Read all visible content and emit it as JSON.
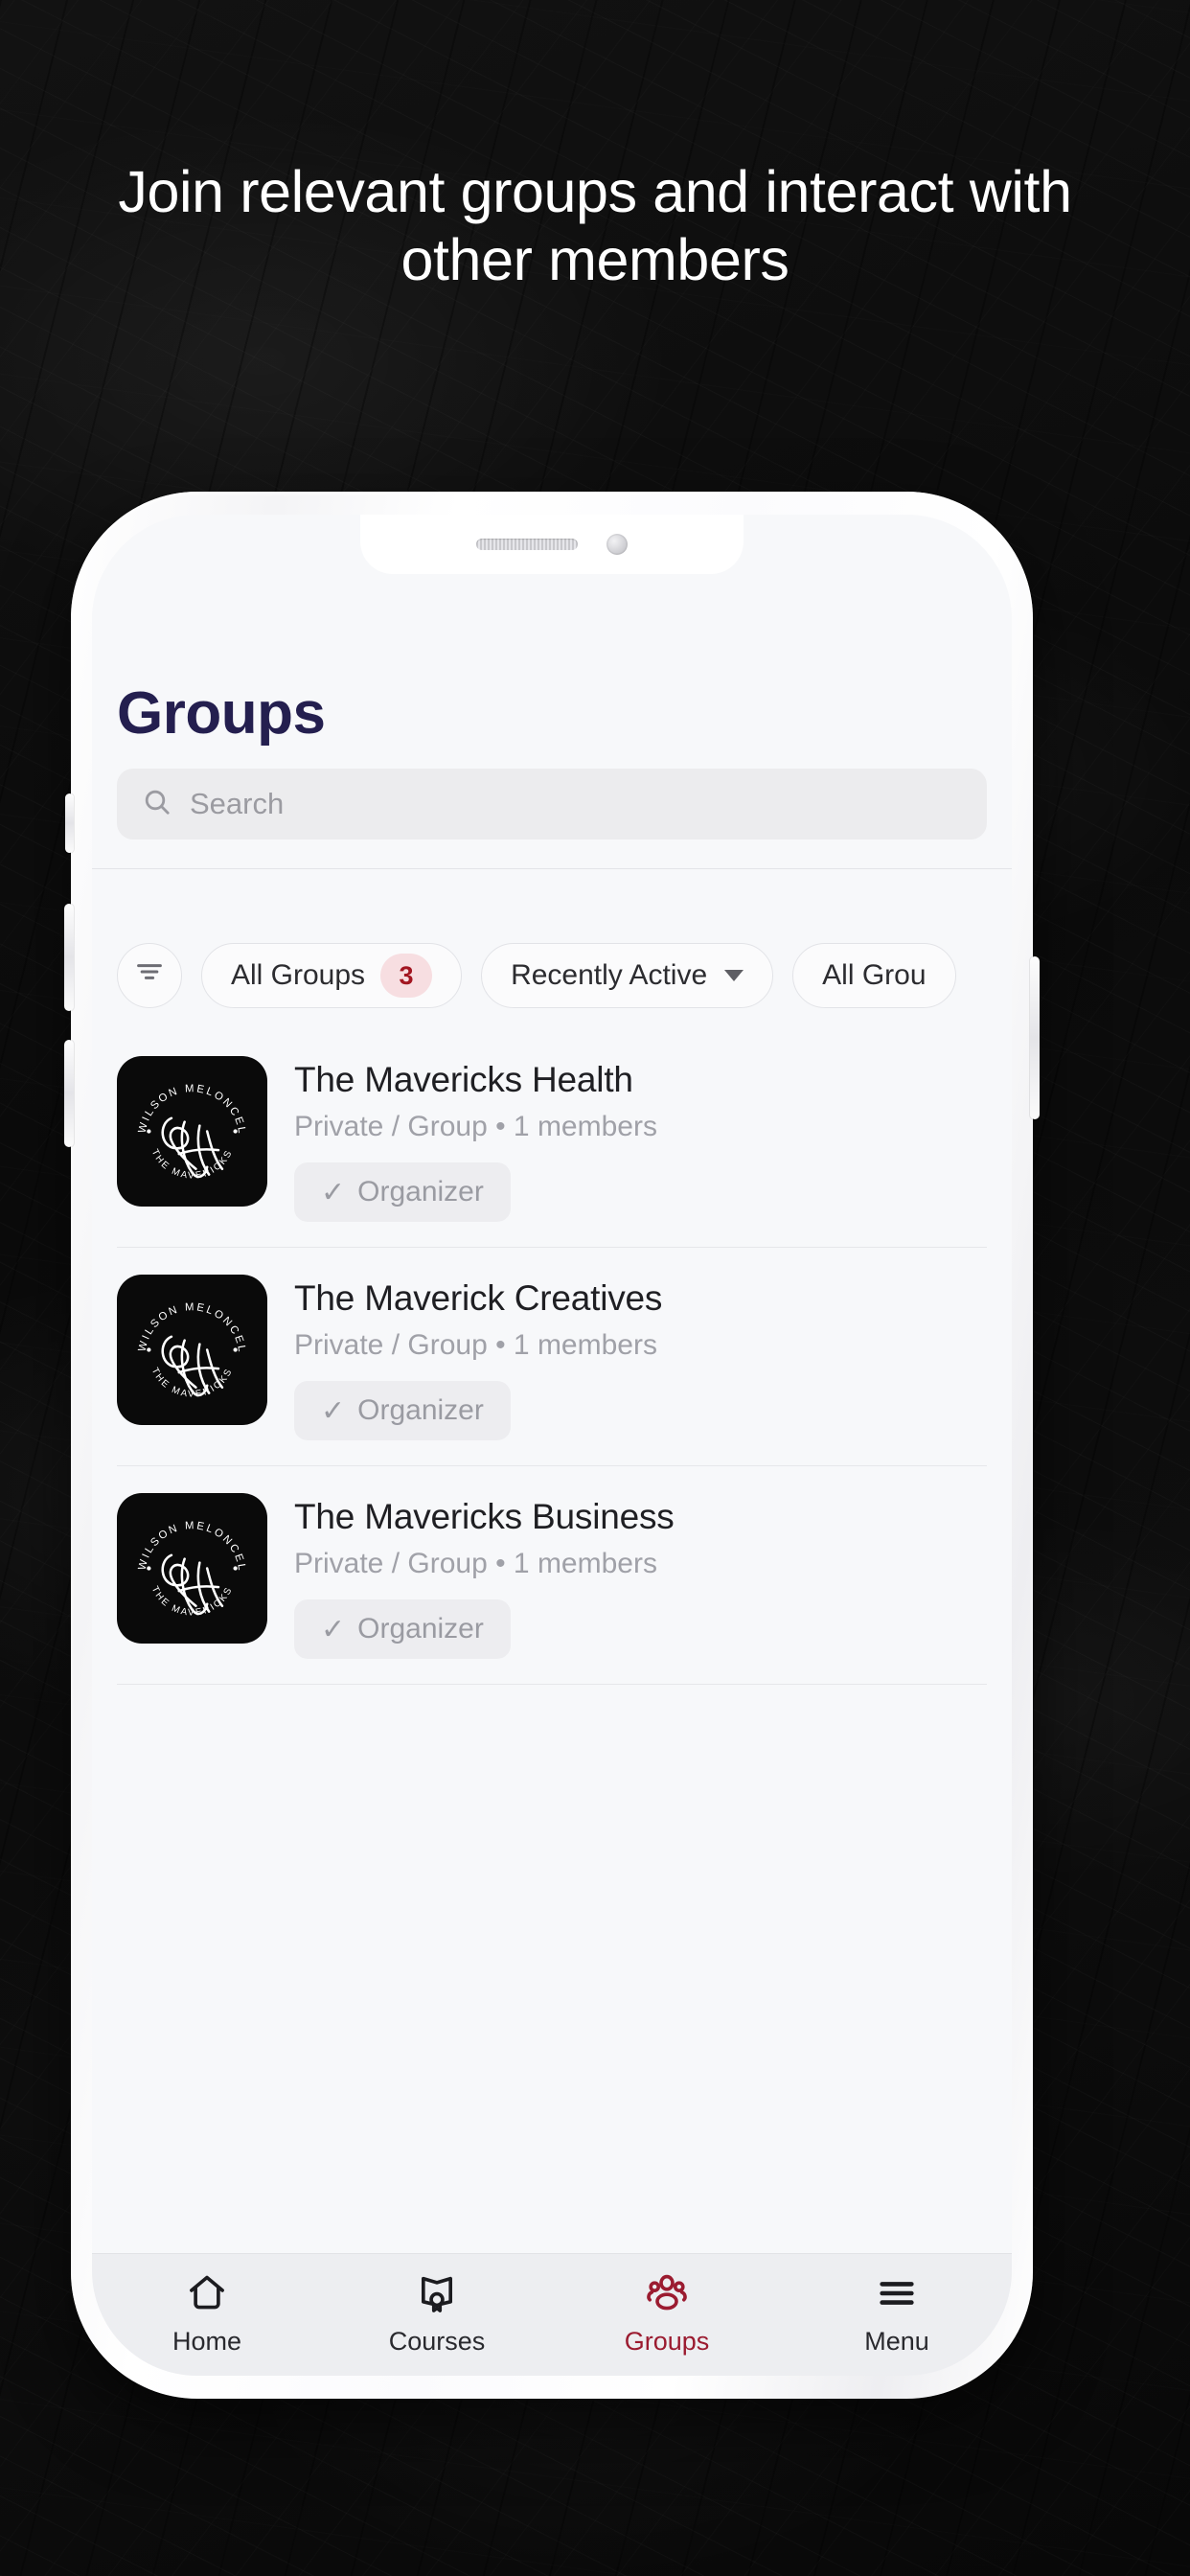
{
  "promo": {
    "headline": "Join relevant groups and interact with other members"
  },
  "phone": {
    "notch": {
      "speaker": "speaker-grille",
      "camera": "front-camera"
    }
  },
  "app": {
    "page_title": "Groups",
    "search": {
      "placeholder": "Search",
      "value": "",
      "icon": "search-icon"
    },
    "filters": {
      "filter_icon": "filter-lines-icon",
      "chips": [
        {
          "label": "All Groups",
          "badge": "3",
          "has_chevron": false
        },
        {
          "label": "Recently Active",
          "badge": "",
          "has_chevron": true
        },
        {
          "label": "All Grou",
          "badge": "",
          "has_chevron": false
        }
      ]
    },
    "groups": [
      {
        "name": "The Mavericks Health",
        "meta": "Private / Group  •  1 members",
        "role_badge": "Organizer",
        "role_check": "✓",
        "avatar_ring_text": "C WILSON MELONCELLI",
        "avatar_bottom_text": "THE MAVERICKS",
        "avatar_monogram": "CM"
      },
      {
        "name": "The Maverick Creatives",
        "meta": "Private / Group  •  1 members",
        "role_badge": "Organizer",
        "role_check": "✓",
        "avatar_ring_text": "C WILSON MELONCELLI",
        "avatar_bottom_text": "THE MAVERICKS",
        "avatar_monogram": "CM"
      },
      {
        "name": "The Mavericks Business",
        "meta": "Private / Group  •  1 members",
        "role_badge": "Organizer",
        "role_check": "✓",
        "avatar_ring_text": "C WILSON MELONCELLI",
        "avatar_bottom_text": "THE MAVERICKS",
        "avatar_monogram": "CM"
      }
    ],
    "bottom_nav": {
      "items": [
        {
          "label": "Home",
          "icon": "home-icon",
          "active": false
        },
        {
          "label": "Courses",
          "icon": "certificate-icon",
          "active": false
        },
        {
          "label": "Groups",
          "icon": "people-group-icon",
          "active": true
        },
        {
          "label": "Menu",
          "icon": "hamburger-icon",
          "active": false
        }
      ],
      "active_color": "#9b1b30"
    }
  },
  "colors": {
    "promo_background": "#0b0b0b",
    "headline_text": "#ffffff",
    "page_title": "#241f4f",
    "badge_bg": "#f7dee1",
    "badge_text": "#a31621",
    "accent": "#9b1b30",
    "screen_bg": "#f7f8fa"
  }
}
